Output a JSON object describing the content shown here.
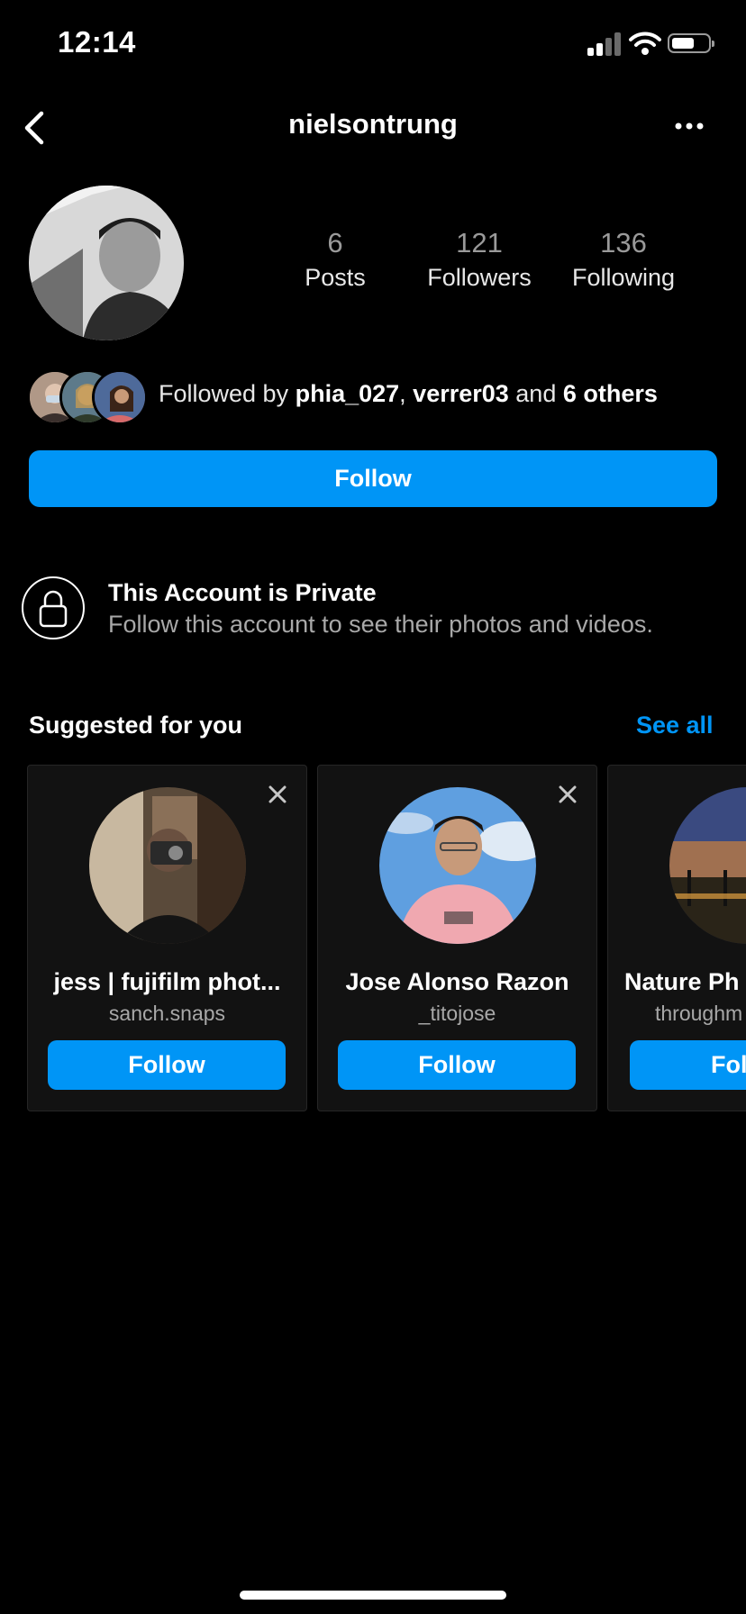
{
  "status_bar": {
    "time": "12:14"
  },
  "nav": {
    "title": "nielsontrung"
  },
  "profile": {
    "stats": [
      {
        "number": "6",
        "label": "Posts"
      },
      {
        "number": "121",
        "label": "Followers"
      },
      {
        "number": "136",
        "label": "Following"
      }
    ],
    "followed_by": {
      "prefix": "Followed by ",
      "user1": "phia_027",
      "sep": ", ",
      "user2": "verrer03",
      "and": " and ",
      "others": "6 others"
    },
    "follow_label": "Follow"
  },
  "private": {
    "title": "This Account is Private",
    "subtitle": "Follow this account to see their photos and videos."
  },
  "suggested": {
    "title": "Suggested for you",
    "see_all": "See all",
    "cards": [
      {
        "name": "jess | fujifilm phot...",
        "handle": "sanch.snaps",
        "button": "Follow"
      },
      {
        "name": "Jose Alonso Razon",
        "handle": "_titojose",
        "button": "Follow"
      },
      {
        "name": "Nature Ph",
        "handle": "throughm",
        "button": "Fol"
      }
    ]
  },
  "colors": {
    "accent": "#0095f6",
    "background": "#000000",
    "card": "#121212"
  }
}
